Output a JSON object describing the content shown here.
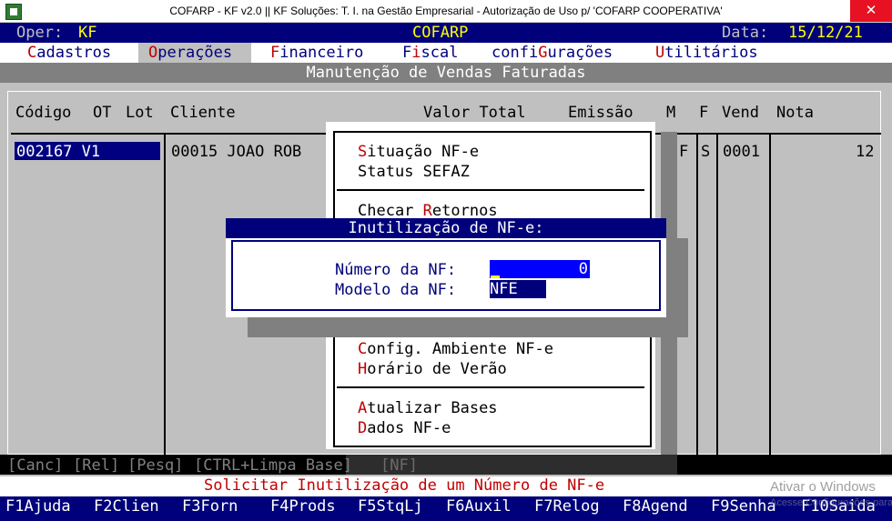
{
  "window": {
    "title": "COFARP   -   KF v2.0  ||  KF Soluções: T. I. na Gestão Empresarial   -  Autorização de Uso p/  'COFARP COOPERATIVA'",
    "close_glyph": "✕"
  },
  "status_row": {
    "oper_label": "Oper:",
    "oper_value": "KF",
    "system_name": "COFARP",
    "date_label": "Data:",
    "date_value": "15/12/21"
  },
  "menubar": [
    {
      "hot": "C",
      "rest": "adastros"
    },
    {
      "hot": "O",
      "rest": "perações"
    },
    {
      "hot": "F",
      "rest": "inanceiro"
    },
    {
      "pre": "F",
      "hot": "i",
      "rest": "scal"
    },
    {
      "pre": "confi",
      "hot": "G",
      "rest": "urações"
    },
    {
      "hot": "U",
      "rest": "tilitários"
    }
  ],
  "screen_title": "Manutenção de Vendas Faturadas",
  "grid": {
    "headers": [
      "Código",
      "OT",
      "Lot",
      "Cliente",
      "Valor Total",
      "Emissão",
      "M",
      "F",
      "Vend",
      "Nota"
    ],
    "row": {
      "codigo": "002167 V1",
      "cliente": "00015 JOAO ROB",
      "f": "F",
      "s": "S",
      "vend": "0001",
      "nota": "12"
    }
  },
  "popup_menu": [
    {
      "hot": "S",
      "rest": "ituação NF-e"
    },
    {
      "hot": "S",
      "rest": "tatus SEFAZ",
      "plain": true
    },
    {
      "pre": "Checar ",
      "hot": "R",
      "rest": "etornos"
    },
    {
      "pre": "",
      "hot": "C",
      "rest": "onfig. Ambiente NF-e"
    },
    {
      "hot": "H",
      "rest": "orário de Verão"
    },
    {
      "hot": "A",
      "rest": "tualizar Bases"
    },
    {
      "hot": "D",
      "rest": "ados NF-e"
    }
  ],
  "dialog": {
    "title": "Inutilização de NF-e:",
    "number_label": "Número da NF:",
    "number_value": "0",
    "model_label": "Modelo da NF:",
    "model_value": "NFE"
  },
  "hints": [
    "[Canc]",
    "[Rel]",
    "[Pesq]",
    "[CTRL+Limpa Base]",
    "[NF]"
  ],
  "status_message": "Solicitar Inutilização de um Número de NF-e",
  "fkeys": [
    "F1Ajuda",
    "F2Clien",
    "F3Forn",
    "F4Prods",
    "F5StqLj",
    "F6Auxil",
    "F7Relog",
    "F8Agend",
    "F9Senha",
    "F10Saida"
  ],
  "watermark": {
    "line1": "Ativar o Windows",
    "line2": "Acesse Configurações para ativar o Windows."
  },
  "colors": {
    "navy": "#00007a",
    "hotkey_red": "#c00000",
    "yellow": "#ffff00",
    "terminal_gray": "#c0c0c0"
  }
}
